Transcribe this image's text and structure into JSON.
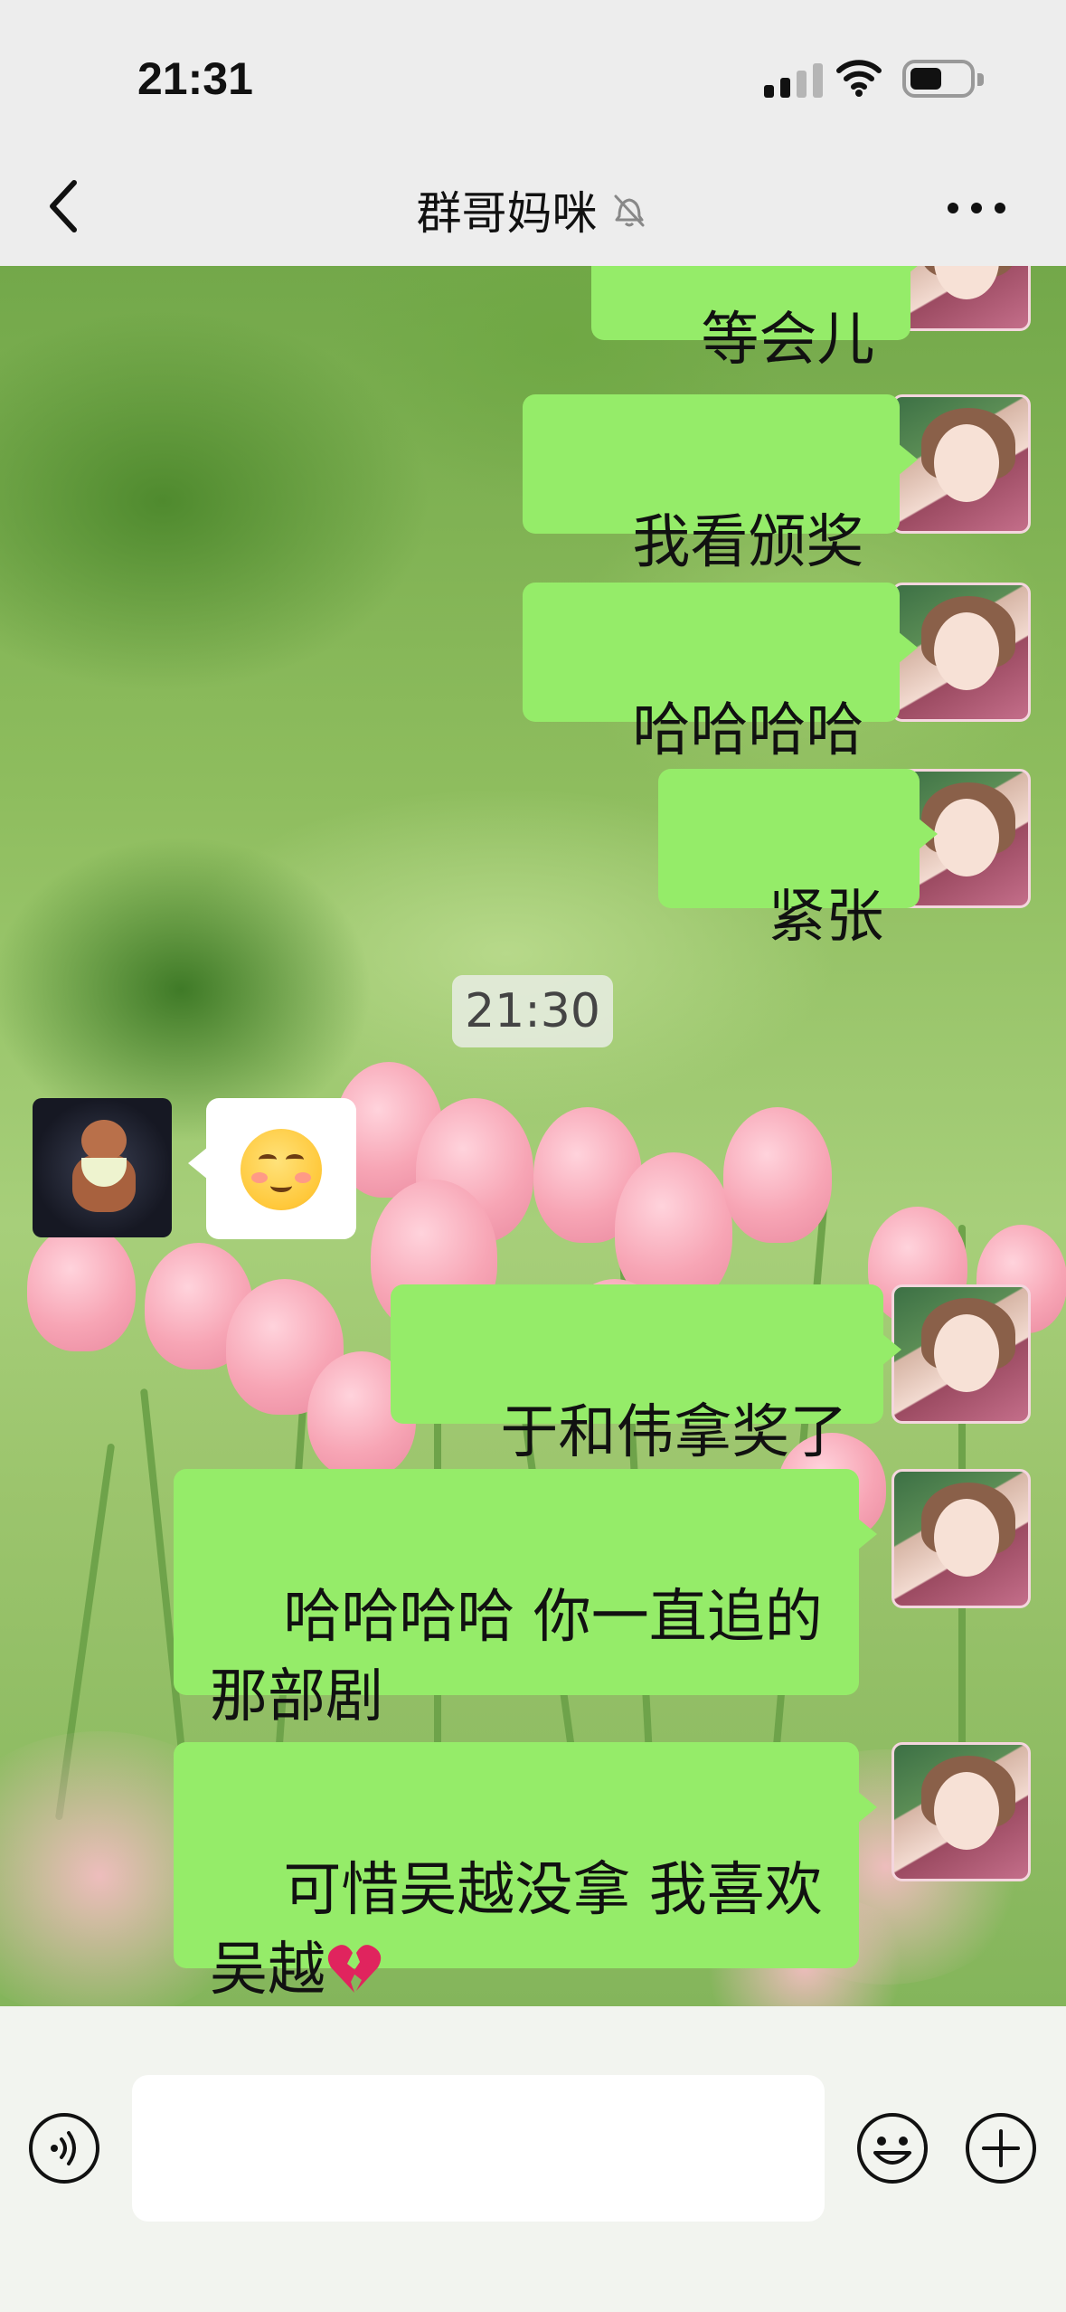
{
  "status_bar": {
    "time": "21:31"
  },
  "nav": {
    "title": "群哥妈咪",
    "muted_icon": "bell-slash-icon",
    "back_icon": "chevron-left-icon",
    "more_icon": "more-dots-icon"
  },
  "messages": [
    {
      "from": "me",
      "text": "等会儿"
    },
    {
      "from": "me",
      "text": "我看颁奖"
    },
    {
      "from": "me",
      "text": "哈哈哈哈"
    },
    {
      "from": "me",
      "text": "紧张"
    },
    {
      "type": "time",
      "text": "21:30"
    },
    {
      "from": "other",
      "emoji": "smiling-face-with-blush"
    },
    {
      "from": "me",
      "text": "于和伟拿奖了"
    },
    {
      "from": "me",
      "text": "哈哈哈哈 你一直追的\n那部剧"
    },
    {
      "from": "me",
      "text": "可惜吴越没拿 我喜欢\n吴越",
      "trailing_emoji": "broken-heart"
    }
  ],
  "input_bar": {
    "voice_icon": "voice-icon",
    "input_value": "",
    "emoji_icon": "emoji-icon",
    "plus_icon": "plus-circle-icon"
  },
  "colors": {
    "outgoing_bubble": "#95ec69",
    "incoming_bubble": "#ffffff",
    "bar_background": "#ededed"
  }
}
